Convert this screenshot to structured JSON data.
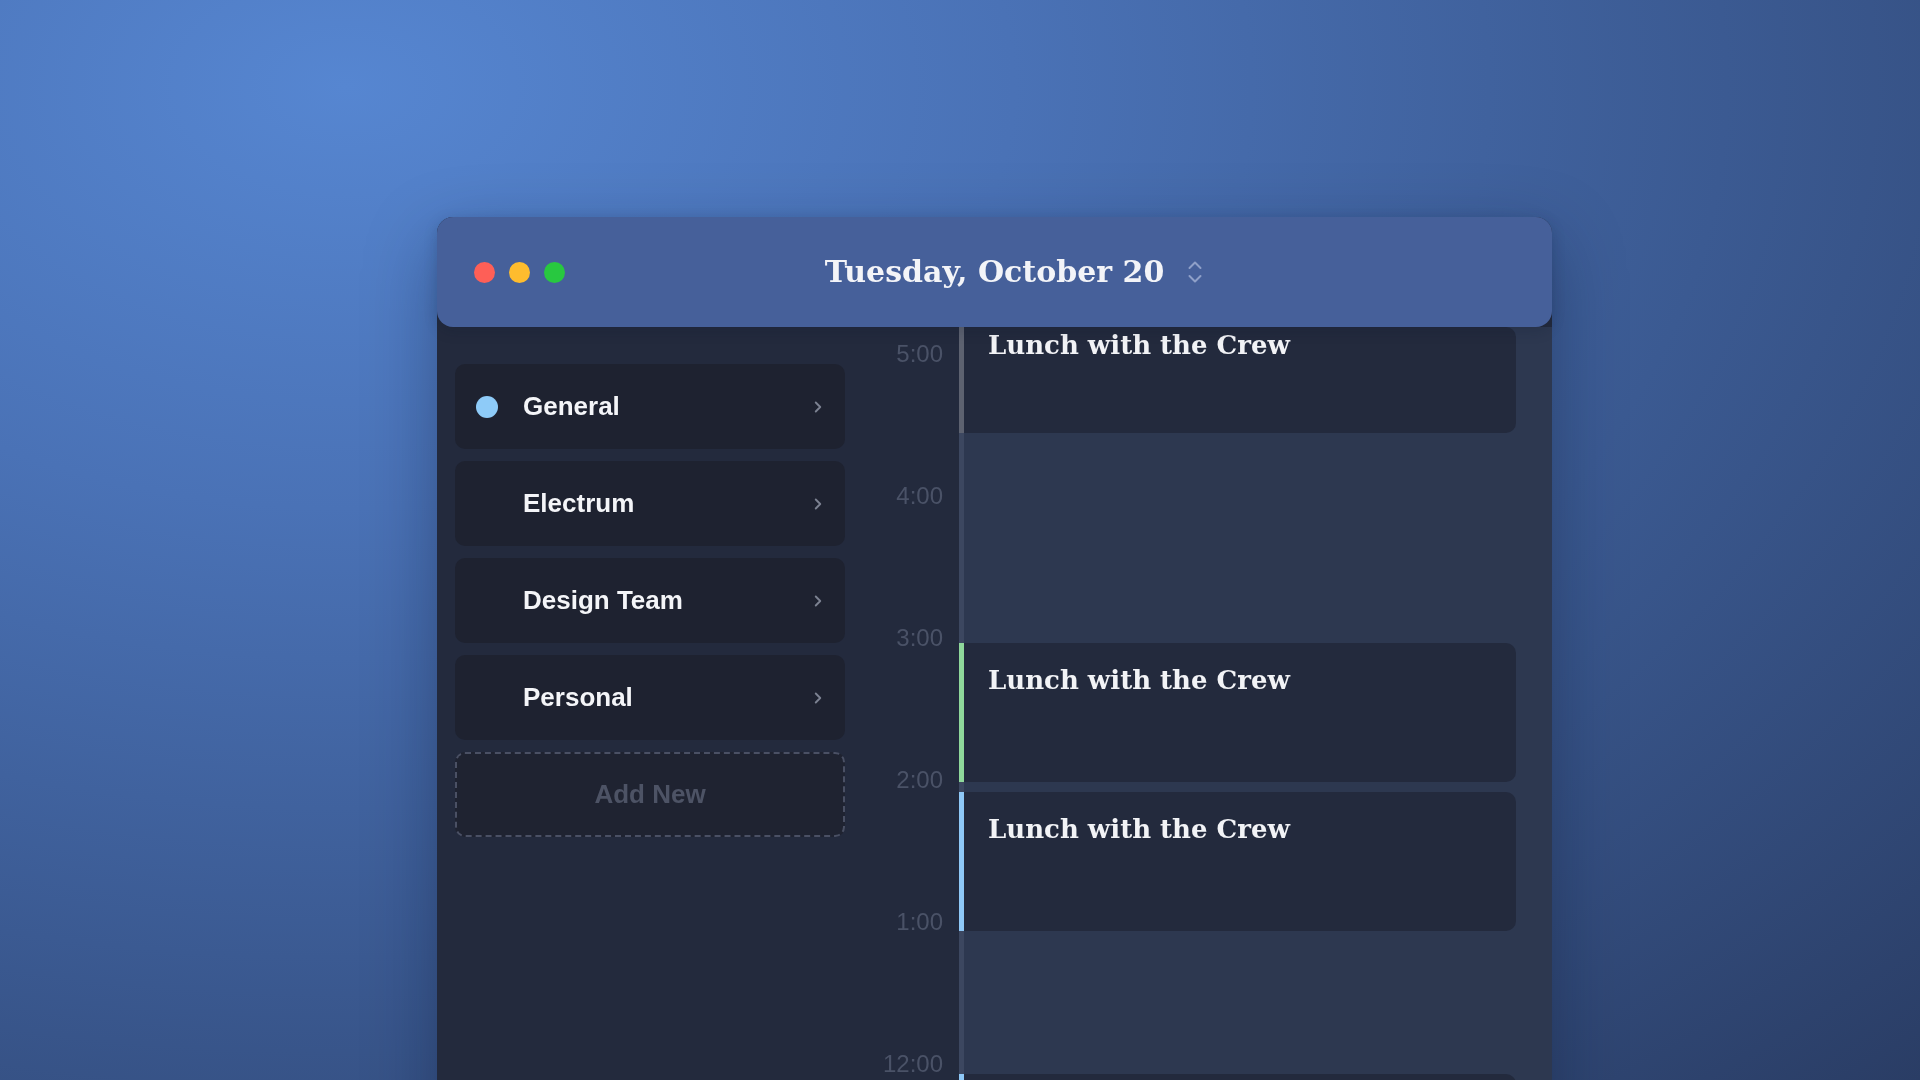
{
  "window": {
    "title": "Tuesday, October 20"
  },
  "calendars": [
    {
      "label": "General",
      "selected": true
    },
    {
      "label": "Electrum",
      "selected": false
    },
    {
      "label": "Design Team",
      "selected": false
    },
    {
      "label": "Personal",
      "selected": false
    }
  ],
  "add_button": {
    "label": "Add New"
  },
  "timeline": {
    "hours": [
      "5:00",
      "4:00",
      "3:00",
      "2:00",
      "1:00",
      "12:00"
    ],
    "events": [
      {
        "title": "Lunch with the Crew",
        "color": "#5d6270"
      },
      {
        "title": "Lunch with the Crew",
        "color": "#8fd89b"
      },
      {
        "title": "Lunch with the Crew",
        "color": "#8ec8f7"
      },
      {
        "color": "#8ec8f7"
      }
    ]
  }
}
